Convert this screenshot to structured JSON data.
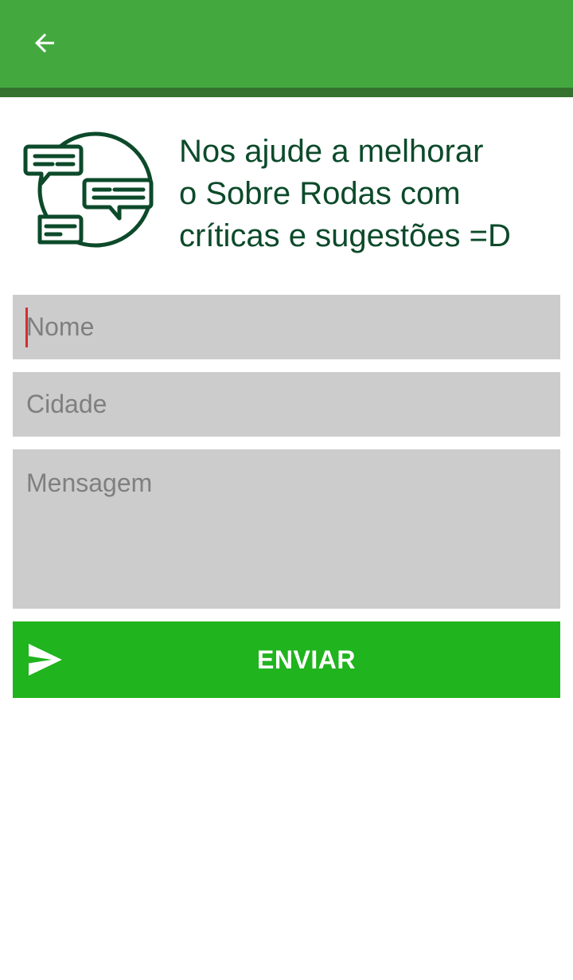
{
  "colors": {
    "appbar": "#43a93f",
    "appbar_shadow": "#35722f",
    "headline_text": "#0c4a2a",
    "field_background": "#cccccc",
    "placeholder_text": "#7f7f7f",
    "caret": "#d32f2f",
    "send_button": "#20b41e",
    "send_button_text": "#ffffff"
  },
  "appbar": {
    "back_icon": "arrow-back-icon"
  },
  "header": {
    "icon": "chat-bubbles-globe-icon",
    "headline_lines": [
      "Nos ajude a melhorar",
      "o Sobre Rodas com",
      "críticas e sugestões =D"
    ]
  },
  "form": {
    "name": {
      "value": "",
      "placeholder": "Nome",
      "focused": true
    },
    "city": {
      "value": "",
      "placeholder": "Cidade"
    },
    "message": {
      "value": "",
      "placeholder": "Mensagem"
    },
    "send": {
      "label": "ENVIAR",
      "icon": "send-icon"
    }
  }
}
